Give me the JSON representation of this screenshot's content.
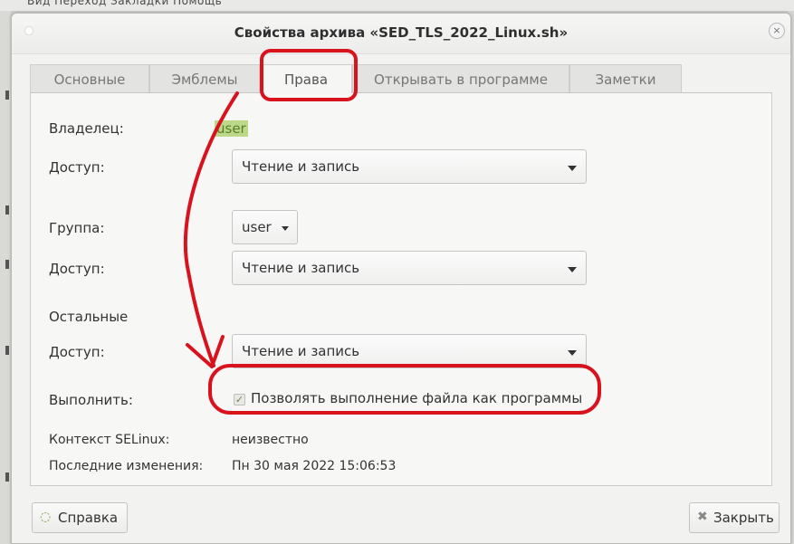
{
  "background": {
    "menu_text": "Вид   Переход   Закладки   Помощь"
  },
  "window": {
    "title": "Свойства архива «SED_TLS_2022_Linux.sh»",
    "close_glyph": "×"
  },
  "tabs": [
    {
      "label": "Основные"
    },
    {
      "label": "Эмблемы"
    },
    {
      "label": "Права"
    },
    {
      "label": "Открывать в программе"
    },
    {
      "label": "Заметки"
    }
  ],
  "permissions": {
    "owner_label": "Владелец:",
    "owner_value": "user",
    "access_label": "Доступ:",
    "owner_access": "Чтение и запись",
    "group_label": "Группа:",
    "group_value": "user",
    "group_access": "Чтение и запись",
    "others_label": "Остальные",
    "others_access": "Чтение и запись",
    "execute_label": "Выполнить:",
    "execute_checkbox_label": "Позволять выполнение файла как программы",
    "execute_checked": true,
    "selinux_label": "Контекст SELinux:",
    "selinux_value": "неизвестно",
    "modified_label": "Последние изменения:",
    "modified_value": "Пн 30 мая 2022 15:06:53"
  },
  "footer": {
    "help_label": "Справка",
    "close_label": "Закрыть"
  },
  "colors": {
    "annotation": "#d8131e",
    "owner_highlight": "#bcd98a"
  }
}
